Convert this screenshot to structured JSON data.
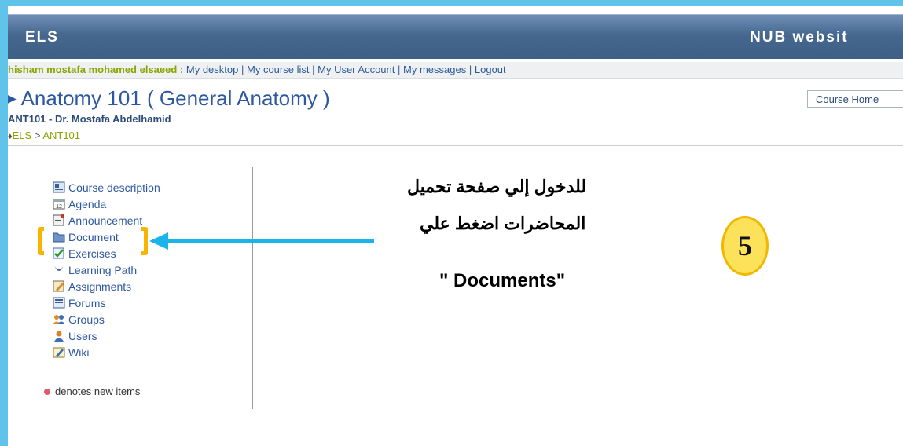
{
  "header": {
    "brand": "ELS",
    "site_link": "NUB websit"
  },
  "userbar": {
    "user_name": "hisham mostafa mohamed elsaeed",
    "colon": " :",
    "links": [
      "My desktop",
      "My course list",
      "My User Account",
      "My messages",
      "Logout"
    ]
  },
  "course": {
    "title": "Anatomy 101 ( General Anatomy )",
    "subtitle": "ANT101 - Dr. Mostafa Abdelhamid",
    "breadcrumb": [
      "ELS",
      "ANT101"
    ],
    "breadcrumb_sep": ">"
  },
  "course_select": {
    "value": "Course Home"
  },
  "menu": {
    "items": [
      {
        "label": "Course description",
        "icon": "course-description-icon"
      },
      {
        "label": "Agenda",
        "icon": "agenda-icon"
      },
      {
        "label": "Announcement",
        "icon": "announcement-icon"
      },
      {
        "label": "Document",
        "icon": "folder-icon"
      },
      {
        "label": "Exercises",
        "icon": "checkmark-icon"
      },
      {
        "label": "Learning Path",
        "icon": "learning-path-icon"
      },
      {
        "label": "Assignments",
        "icon": "assignments-icon"
      },
      {
        "label": "Forums",
        "icon": "forums-icon"
      },
      {
        "label": "Groups",
        "icon": "groups-icon"
      },
      {
        "label": "Users",
        "icon": "user-icon"
      },
      {
        "label": "Wiki",
        "icon": "wiki-icon"
      }
    ]
  },
  "legend": {
    "text": "denotes new items"
  },
  "annotation": {
    "line1": "للدخول إلي صفحة تحميل",
    "line2": "المحاضرات اضغط علي",
    "line3": "\" Documents\"",
    "step_number": "5"
  },
  "colors": {
    "header": "#46688f",
    "link": "#2d58a0",
    "accent_green": "#8aa400",
    "arrow": "#1ab3ea",
    "highlight": "#f7b500"
  }
}
